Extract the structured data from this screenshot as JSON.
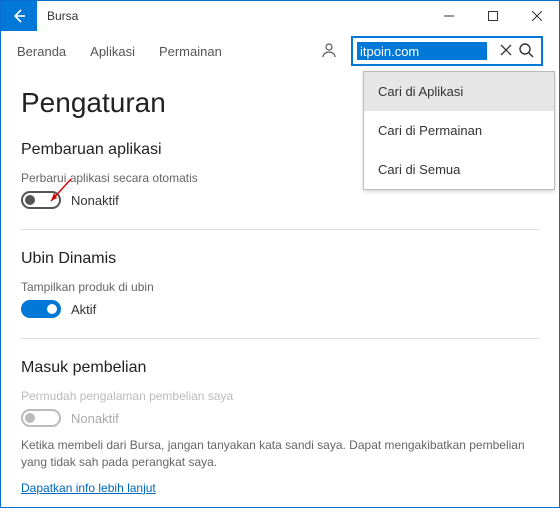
{
  "titlebar": {
    "back_aria": "Back",
    "app_title": "Bursa",
    "min": "—",
    "max": "□",
    "close": "✕"
  },
  "nav": {
    "tab_home": "Beranda",
    "tab_apps": "Aplikasi",
    "tab_games": "Permainan"
  },
  "search": {
    "value": "itpoin.com",
    "clear": "✕",
    "options": {
      "apps": "Cari di Aplikasi",
      "games": "Cari di Permainan",
      "all": "Cari di Semua"
    }
  },
  "page": {
    "title": "Pengaturan",
    "section_updates": {
      "heading": "Pembaruan aplikasi",
      "label": "Perbarui aplikasi secara otomatis",
      "state": "Nonaktif"
    },
    "section_tiles": {
      "heading": "Ubin Dinamis",
      "label": "Tampilkan produk di ubin",
      "state": "Aktif"
    },
    "section_signin": {
      "heading": "Masuk pembelian",
      "label": "Permudah pengalaman pembelian saya",
      "state": "Nonaktif",
      "desc": "Ketika membeli dari Bursa, jangan tanyakan kata sandi saya. Dapat mengakibatkan pembelian yang tidak sah pada perangkat saya.",
      "link": "Dapatkan info lebih lanjut"
    }
  }
}
